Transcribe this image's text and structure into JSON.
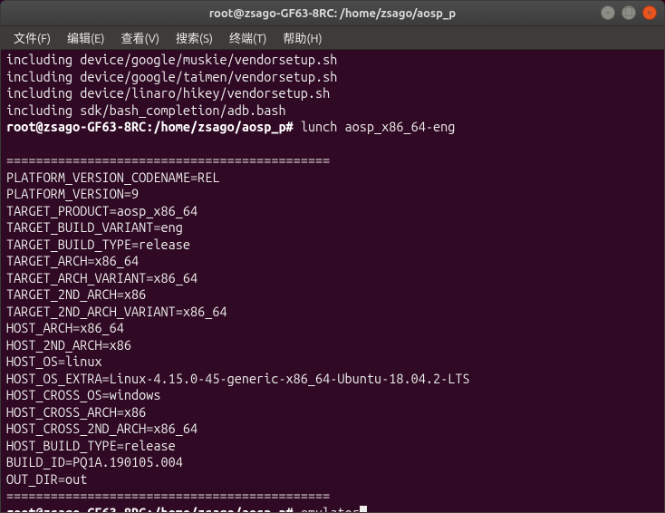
{
  "titlebar": {
    "title": "root@zsago-GF63-8RC: /home/zsago/aosp_p"
  },
  "window_controls": {
    "minimize": "−",
    "maximize": "□",
    "close": "×"
  },
  "menubar": {
    "items": [
      "文件(F)",
      "编辑(E)",
      "查看(V)",
      "搜索(S)",
      "终端(T)",
      "帮助(H)"
    ]
  },
  "terminal": {
    "prompt": "root@zsago-GF63-8RC:/home/zsago/aosp_p#",
    "lines": [
      "including device/google/muskie/vendorsetup.sh",
      "including device/google/taimen/vendorsetup.sh",
      "including device/linaro/hikey/vendorsetup.sh",
      "including sdk/bash_completion/adb.bash"
    ],
    "cmd1": "lunch aosp_x86_64-eng",
    "sep": "============================================",
    "build_vars": [
      "PLATFORM_VERSION_CODENAME=REL",
      "PLATFORM_VERSION=9",
      "TARGET_PRODUCT=aosp_x86_64",
      "TARGET_BUILD_VARIANT=eng",
      "TARGET_BUILD_TYPE=release",
      "TARGET_ARCH=x86_64",
      "TARGET_ARCH_VARIANT=x86_64",
      "TARGET_2ND_ARCH=x86",
      "TARGET_2ND_ARCH_VARIANT=x86_64",
      "HOST_ARCH=x86_64",
      "HOST_2ND_ARCH=x86",
      "HOST_OS=linux",
      "HOST_OS_EXTRA=Linux-4.15.0-45-generic-x86_64-Ubuntu-18.04.2-LTS",
      "HOST_CROSS_OS=windows",
      "HOST_CROSS_ARCH=x86",
      "HOST_CROSS_2ND_ARCH=x86_64",
      "HOST_BUILD_TYPE=release",
      "BUILD_ID=PQ1A.190105.004",
      "OUT_DIR=out"
    ],
    "cmd2": "emulator"
  }
}
